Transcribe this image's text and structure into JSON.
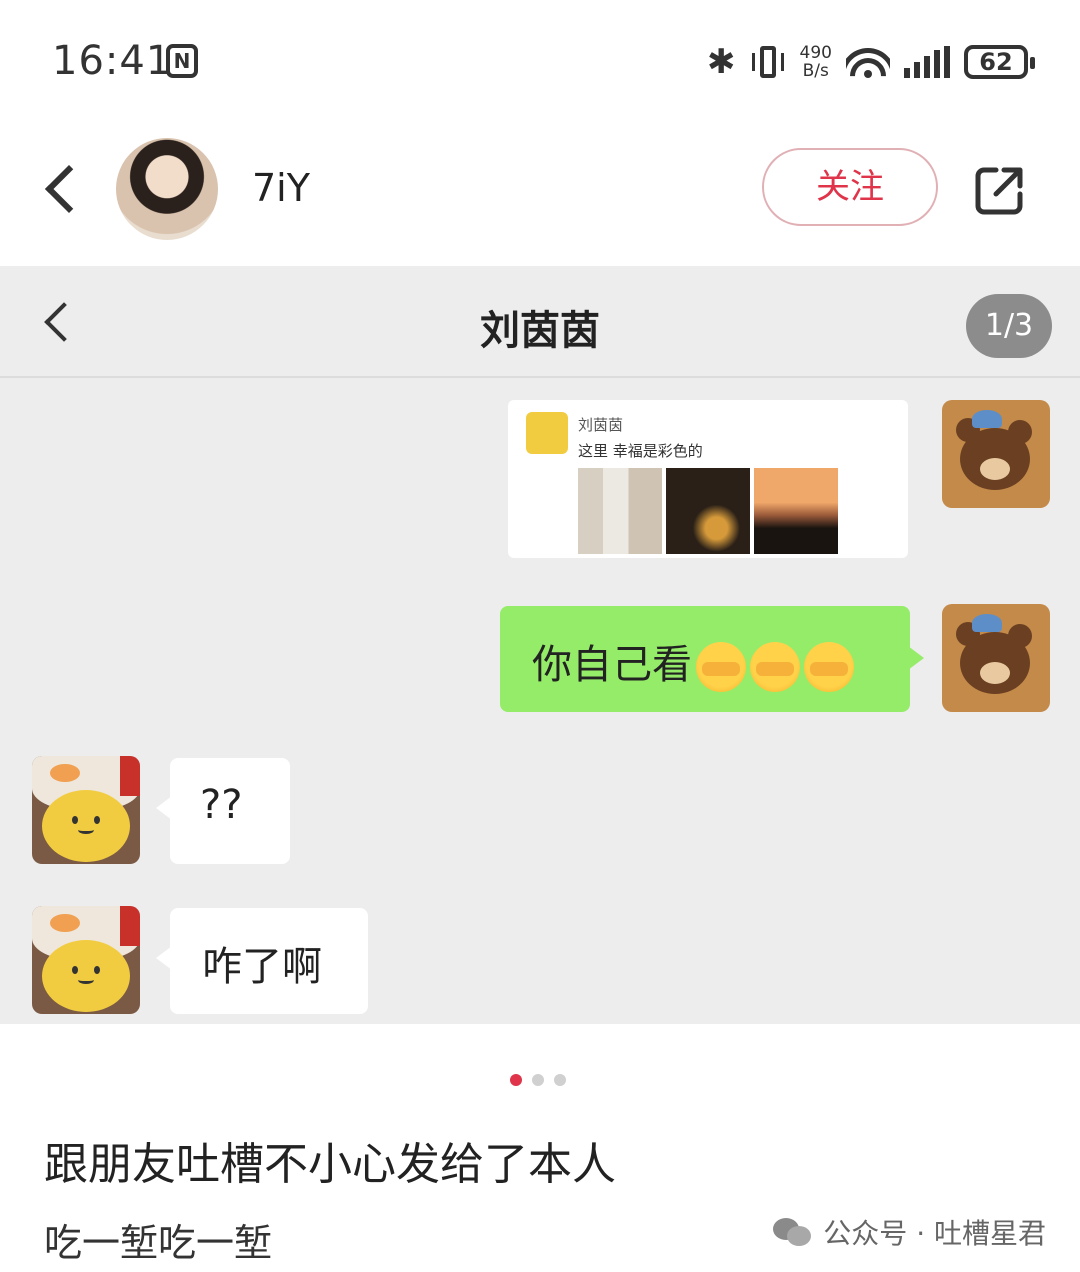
{
  "status_bar": {
    "time": "16:41",
    "nfc_glyph": "N",
    "net_speed_value": "490",
    "net_speed_unit": "B/s",
    "battery": "62",
    "icons": [
      "nfc-icon",
      "bluetooth-icon",
      "vibrate-icon",
      "wifi-icon",
      "signal-icon",
      "battery-icon"
    ]
  },
  "header": {
    "username": "7iY",
    "follow_label": "关注",
    "accent_color": "#e0344a"
  },
  "chat_screenshot": {
    "title": "刘茵茵",
    "page_indicator": "1/3",
    "shared_card": {
      "name": "刘茵茵",
      "text": "这里 幸福是彩色的"
    },
    "messages": [
      {
        "side": "right",
        "type": "card"
      },
      {
        "side": "right",
        "type": "text",
        "text": "你自己看",
        "emoji": [
          "facepalm-cry-emoji",
          "facepalm-cry-emoji",
          "facepalm-cry-emoji"
        ],
        "bubble_color": "#95ec69"
      },
      {
        "side": "left",
        "type": "text",
        "text": "??"
      },
      {
        "side": "left",
        "type": "text",
        "text": "咋了啊"
      }
    ]
  },
  "pagination": {
    "count": 3,
    "active": 1
  },
  "post": {
    "title": "跟朋友吐槽不小心发给了本人",
    "subtitle": "吃一堑吃一堑"
  },
  "watermark": {
    "text": "公众号 · 吐槽星君"
  }
}
